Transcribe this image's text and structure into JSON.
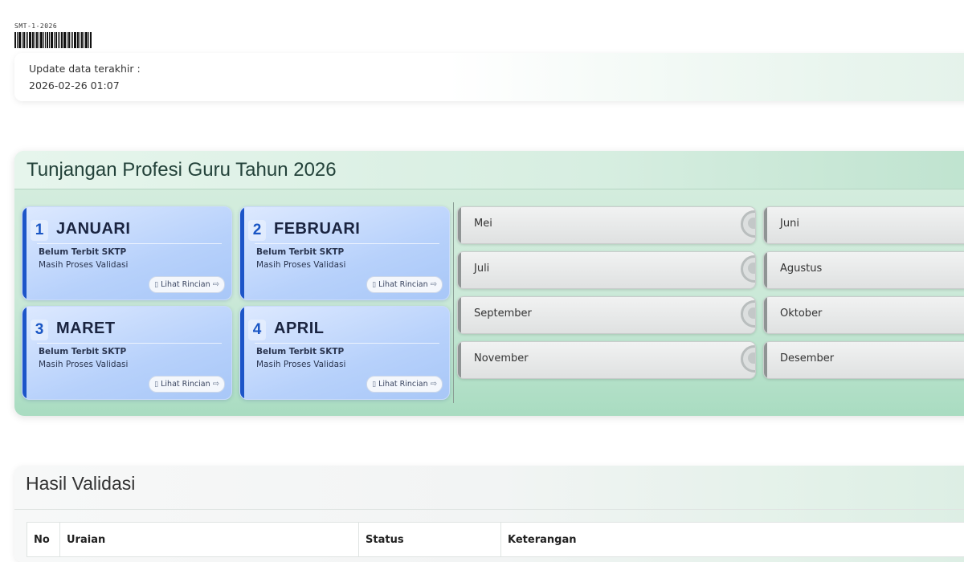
{
  "barcode": {
    "text": "SMT-1-2026"
  },
  "update": {
    "label": "Update data terakhir :",
    "value": "2026-02-26 01:07"
  },
  "tpg": {
    "title": "Tunjangan Profesi Guru Tahun 2026",
    "active_months": [
      {
        "num": "1",
        "name": "JANUARI",
        "status1": "Belum Terbit SKTP",
        "status2": "Masih Proses Validasi",
        "button": "Lihat Rincian"
      },
      {
        "num": "2",
        "name": "FEBRUARI",
        "status1": "Belum Terbit SKTP",
        "status2": "Masih Proses Validasi",
        "button": "Lihat Rincian"
      },
      {
        "num": "3",
        "name": "MARET",
        "status1": "Belum Terbit SKTP",
        "status2": "Masih Proses Validasi",
        "button": "Lihat Rincian"
      },
      {
        "num": "4",
        "name": "APRIL",
        "status1": "Belum Terbit SKTP",
        "status2": "Masih Proses Validasi",
        "button": "Lihat Rincian"
      }
    ],
    "inactive_months": [
      "Mei",
      "Juni",
      "Juli",
      "Agustus",
      "September",
      "Oktober",
      "November",
      "Desember"
    ]
  },
  "hasil": {
    "title": "Hasil Validasi",
    "columns": [
      "No",
      "Uraian",
      "Status",
      "Keterangan"
    ]
  }
}
